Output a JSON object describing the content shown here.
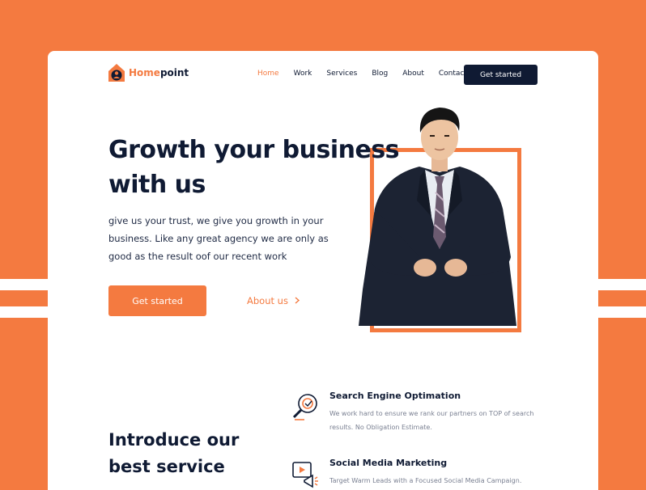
{
  "brand": {
    "name_part1": "Home",
    "name_part2": "point",
    "accent_color": "#F47A40",
    "dark_color": "#0F1A33"
  },
  "nav": {
    "items": [
      "Home",
      "Work",
      "Services",
      "Blog",
      "About",
      "Contact"
    ],
    "active": "Home",
    "cta_label": "Get started"
  },
  "hero": {
    "title_line1": "Growth your business",
    "title_line2": "with us",
    "description": "give us your trust, we give you growth in your business. Like any great agency we are only as good as the result oof our recent work",
    "primary_button": "Get started",
    "secondary_link": "About us",
    "secondary_link_icon": "chevron-right-icon"
  },
  "services_section": {
    "title_line1": "Introduce our",
    "title_line2": "best service",
    "items": [
      {
        "title": "Search Engine Optimation",
        "description": "We work hard to ensure we rank our partners on TOP of search results. No Obligation Estimate.",
        "icon": "seo-magnifier-icon"
      },
      {
        "title": "Social Media Marketing",
        "description": "Target Warm Leads with a Focused Social Media Campaign.",
        "icon": "megaphone-video-icon"
      }
    ]
  }
}
